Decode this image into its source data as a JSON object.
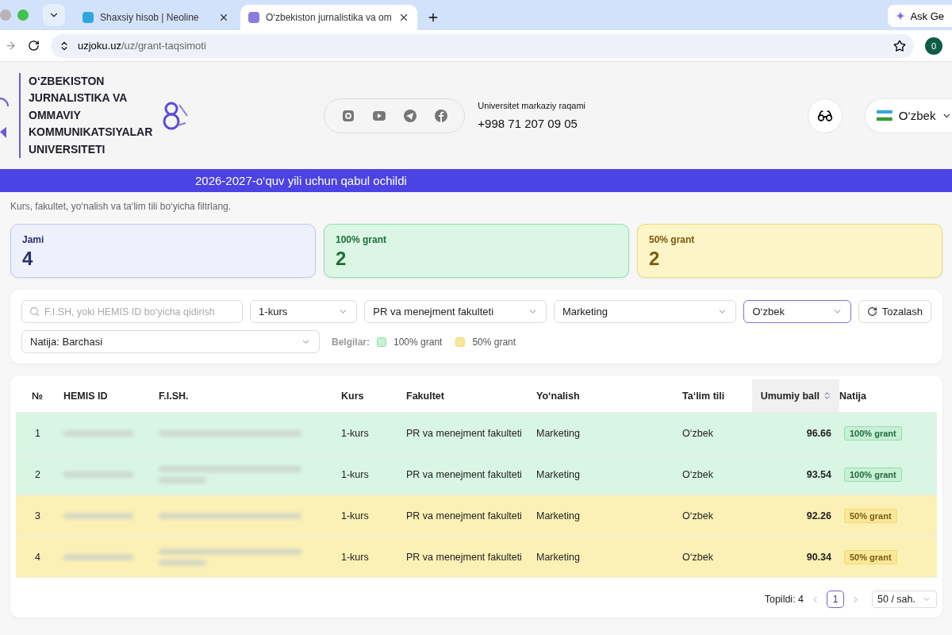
{
  "browser": {
    "tabs": [
      {
        "title": "Shaxsiy hisob | Neoline",
        "selected": false
      },
      {
        "title": "O‘zbekiston jurnalistika va om",
        "selected": true
      }
    ],
    "ask_button": "Ask Ge",
    "url_host": "uzjoku.uz",
    "url_path": "/uz/grant-taqsimoti",
    "profile": "0"
  },
  "header": {
    "logo_lines": [
      "O‘ZBEKISTON",
      "JURNALISTIKA VA",
      "OMMAVIY",
      "KOMMUNIKATSIYALAR",
      "UNIVERSITETI"
    ],
    "phone_label": "Universitet markaziy raqami",
    "phone": "+998 71 207 09 05",
    "language": "O‘zbek"
  },
  "banner": "2026-2027-o‘quv yili uchun qabul ochildi",
  "subtitle": "Kurs, fakultet, yo‘nalish va ta‘lim tili bo‘yicha filtrlang.",
  "stats": [
    {
      "label": "Jami",
      "value": "4",
      "kind": "total"
    },
    {
      "label": "100% grant",
      "value": "2",
      "kind": "full"
    },
    {
      "label": "50% grant",
      "value": "2",
      "kind": "half"
    }
  ],
  "filters": {
    "search_placeholder": "F.I.SH, yoki HEMIS ID bo‘yicha qidirish",
    "selects": [
      {
        "value": "1-kurs",
        "selected": false
      },
      {
        "value": "PR va menejment fakulteti",
        "selected": false
      },
      {
        "value": "Marketing",
        "selected": false
      },
      {
        "value": "O‘zbek",
        "selected": true
      }
    ],
    "reset": "Tozalash",
    "result": "Natija: Barchasi",
    "legend_label": "Belgilar:",
    "legend": [
      {
        "label": "100% grant",
        "kind": "full"
      },
      {
        "label": "50% grant",
        "kind": "half"
      }
    ]
  },
  "table": {
    "columns": [
      "№",
      "HEMIS ID",
      "F.I.SH.",
      "Kurs",
      "Fakultet",
      "Yo‘nalish",
      "Ta‘lim tili",
      "Umumiy ball",
      "Natija"
    ],
    "rows": [
      {
        "no": "1",
        "course": "1-kurs",
        "faculty": "PR va menejment fakulteti",
        "major": "Marketing",
        "language": "O‘zbek",
        "score": "96.66",
        "result": "100% grant",
        "kind": "full"
      },
      {
        "no": "2",
        "course": "1-kurs",
        "faculty": "PR va menejment fakulteti",
        "major": "Marketing",
        "language": "O‘zbek",
        "score": "93.54",
        "result": "100% grant",
        "kind": "full"
      },
      {
        "no": "3",
        "course": "1-kurs",
        "faculty": "PR va menejment fakulteti",
        "major": "Marketing",
        "language": "O‘zbek",
        "score": "92.26",
        "result": "50% grant",
        "kind": "half"
      },
      {
        "no": "4",
        "course": "1-kurs",
        "faculty": "PR va menejment fakulteti",
        "major": "Marketing",
        "language": "O‘zbek",
        "score": "90.34",
        "result": "50% grant",
        "kind": "half"
      }
    ]
  },
  "footer": {
    "found": "Topildi: 4",
    "page": "1",
    "page_size": "50 / sah."
  }
}
